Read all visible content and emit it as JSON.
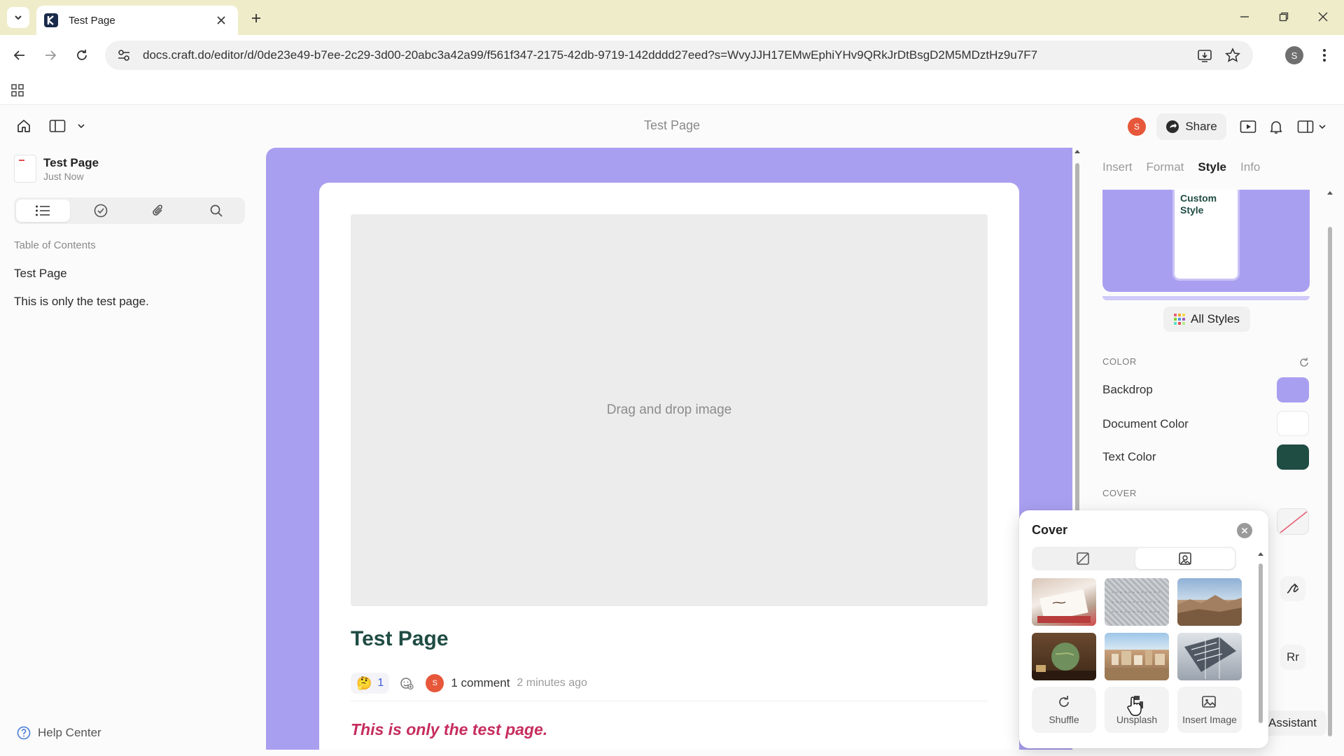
{
  "browser": {
    "tab_title": "Test Page",
    "url": "docs.craft.do/editor/d/0de23e49-b7ee-2c29-3d00-20abc3a42a99/f561f347-2175-42db-9719-142dddd27eed?s=WvyJJH17EMwEphiYHv9QRkJrDtBsgD2M5MDztHz9u7F7",
    "profile_initial": "S"
  },
  "toolbar": {
    "doc_title": "Test Page",
    "user_initial": "S",
    "share_label": "Share"
  },
  "sidebar": {
    "doc_name": "Test Page",
    "doc_time": "Just Now",
    "toc_title": "Table of Contents",
    "toc_items": [
      "Test Page",
      "This is only the test page."
    ],
    "help_label": "Help Center"
  },
  "document": {
    "cover_placeholder": "Drag and drop image",
    "title": "Test Page",
    "reaction_emoji": "🤔",
    "reaction_count": "1",
    "commenter_initial": "S",
    "comment_count": "1 comment",
    "comment_time": "2 minutes ago",
    "body_text": "This is only the test page."
  },
  "panel": {
    "tabs": [
      "Insert",
      "Format",
      "Style",
      "Info"
    ],
    "active_tab": "Style",
    "preview_label": "Custom Style",
    "all_styles_label": "All Styles",
    "color_section": "COLOR",
    "backdrop_label": "Backdrop",
    "backdrop_color": "#a99ff0",
    "document_color_label": "Document Color",
    "document_color": "#ffffff",
    "text_color_label": "Text Color",
    "text_color": "#1f4c43",
    "cover_section": "COVER",
    "font_icon_label": "Rr",
    "assistant_label": "Assistant"
  },
  "cover_popover": {
    "title": "Cover",
    "actions": [
      "Shuffle",
      "Unsplash",
      "Insert Image"
    ]
  }
}
